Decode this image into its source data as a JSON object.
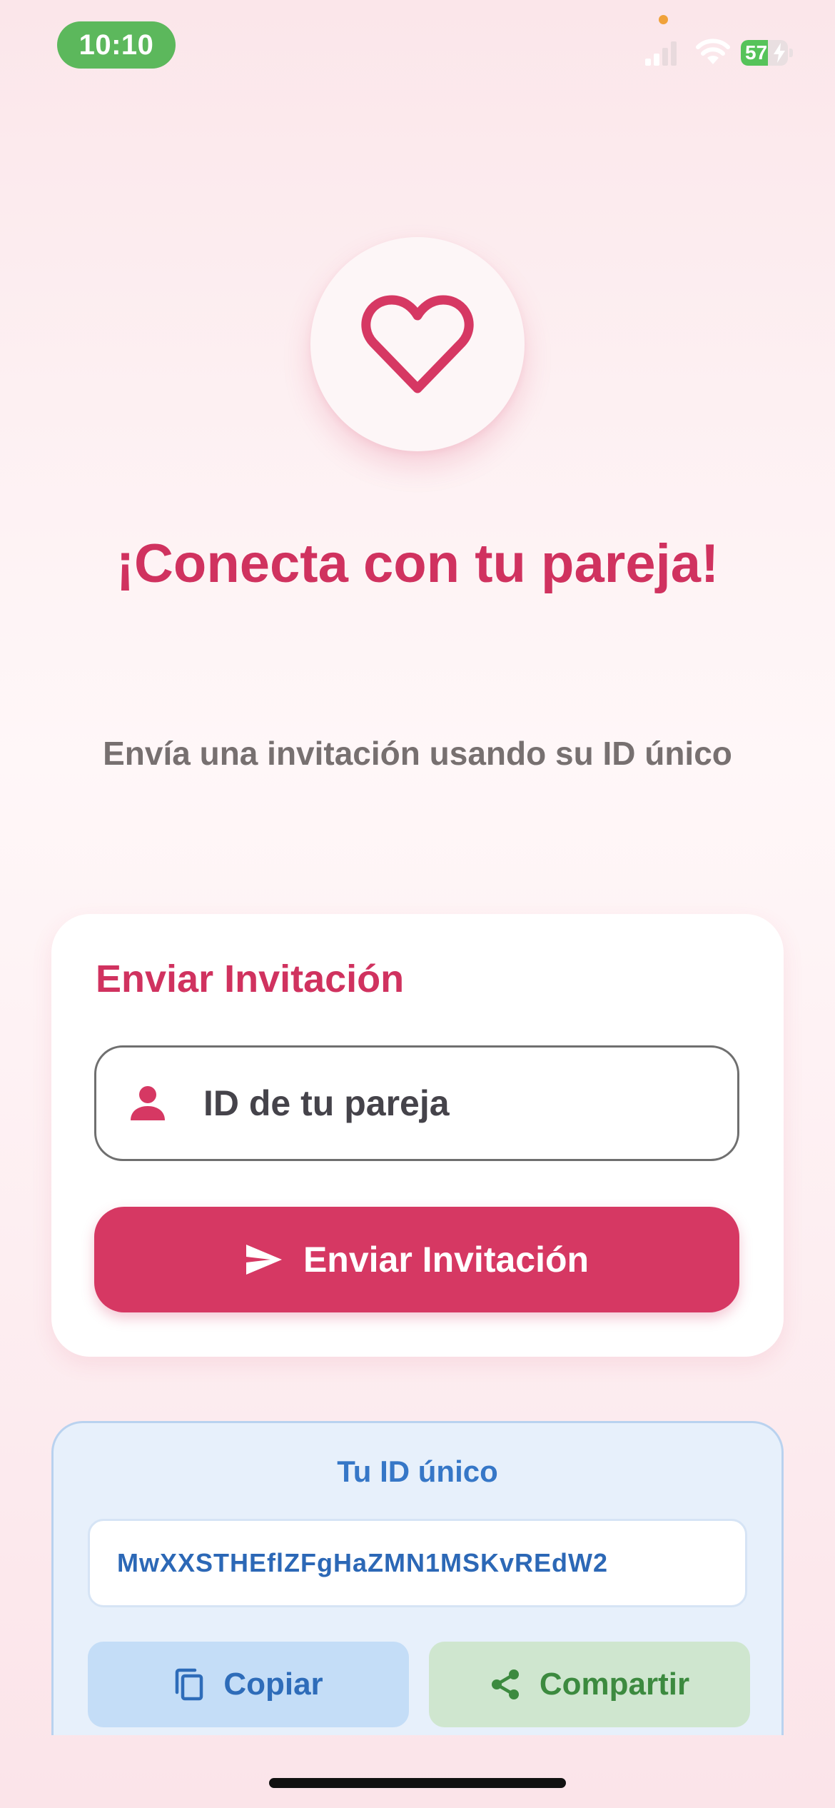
{
  "status_bar": {
    "time": "10:10",
    "battery_level": "57",
    "battery_fraction": 0.57,
    "signal_icon": "cellular-signal-icon",
    "wifi_icon": "wifi-icon",
    "time_pill_color": "#5cb85c"
  },
  "hero": {
    "icon": "heart-outline-icon",
    "title": "¡Conecta con tu pareja!",
    "subtitle": "Envía una invitación usando su ID único"
  },
  "invite_card": {
    "title": "Enviar Invitación",
    "input_icon": "person-icon",
    "input_placeholder": "ID de tu pareja",
    "input_value": "",
    "send_button_icon": "send-icon",
    "send_button_label": "Enviar Invitación"
  },
  "id_card": {
    "title": "Tu ID único",
    "id_value": "MwXXSTHEflZFgHaZMN1MSKvREdW2",
    "copy_button_icon": "copy-icon",
    "copy_button_label": "Copiar",
    "share_button_icon": "share-icon",
    "share_button_label": "Compartir"
  },
  "colors": {
    "primary": "#d63863",
    "title": "#d0325f",
    "subtitle": "#777070",
    "id_blue": "#2c68b6",
    "share_green": "#3c8a3f"
  }
}
